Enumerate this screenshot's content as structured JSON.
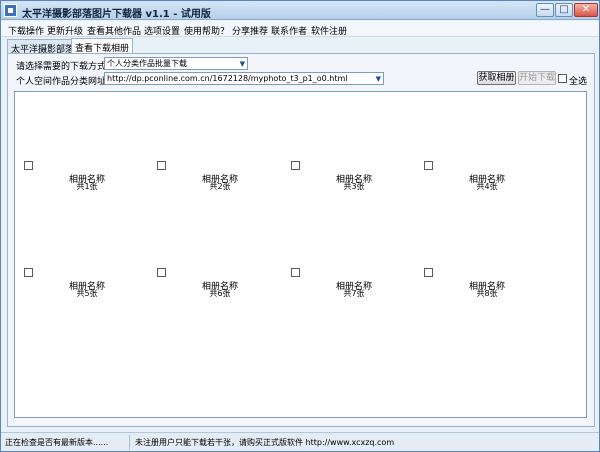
{
  "window": {
    "title": "太平洋摄影部落图片下载器 v1.1 - 试用版",
    "controls": {
      "minimize": "—",
      "maximize": "□",
      "close": "✕"
    }
  },
  "menu": [
    "下载操作",
    "更新升级",
    "查看其他作品",
    "选项设置",
    "使用帮助？",
    "分享推荐",
    "联系作者",
    "软件注册"
  ],
  "tabs": [
    "太平洋摄影部落",
    "查看下载相册"
  ],
  "form": {
    "mode_label": "请选择需要的下载方式:",
    "mode_value": "个人分类作品批量下载",
    "url_label": "个人空间作品分类网址:",
    "url_value": "http://dp.pconline.com.cn/1672128/myphoto_t3_p1_o0.html",
    "fetch_button": "获取相册",
    "download_button": "开始下载",
    "select_all_label": "全选"
  },
  "albums": [
    {
      "name": "相册名称",
      "count": "共1张"
    },
    {
      "name": "相册名称",
      "count": "共2张"
    },
    {
      "name": "相册名称",
      "count": "共3张"
    },
    {
      "name": "相册名称",
      "count": "共4张"
    },
    {
      "name": "相册名称",
      "count": "共5张"
    },
    {
      "name": "相册名称",
      "count": "共6张"
    },
    {
      "name": "相册名称",
      "count": "共7张"
    },
    {
      "name": "相册名称",
      "count": "共8张"
    }
  ],
  "status": {
    "left": "正在检查是否有最新版本......",
    "right": "未注册用户只能下载若干张，请购买正式版软件 http://www.xcxzq.com"
  }
}
